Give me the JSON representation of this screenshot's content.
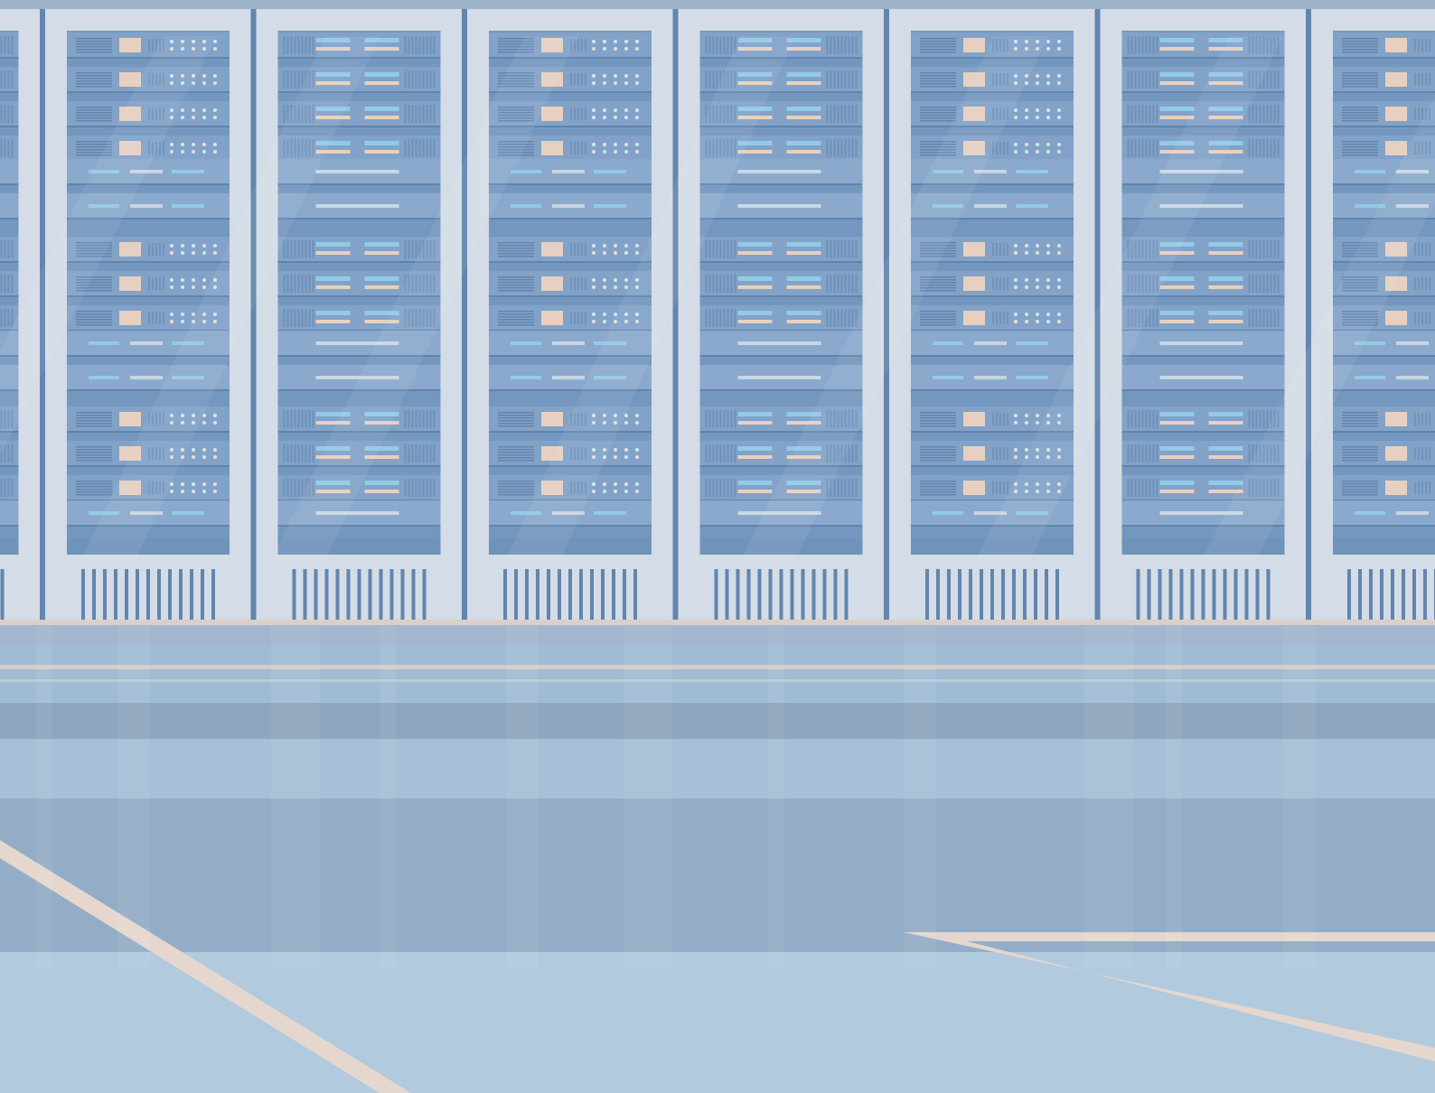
{
  "scene": {
    "kind": "illustration",
    "subject": "server-room",
    "rack_count": 7,
    "partial_racks": 2,
    "units_per_rack": 15,
    "colors": {
      "wall": "#8fa7c1",
      "rack_frame": "#d2dbe6",
      "rack_shadow": "#5d81ab",
      "cabinet": "#6f93bd",
      "unit": "#7d9fc6",
      "unit_dark": "#5b7fab",
      "led_blue": "#8ec8e6",
      "led_beige": "#e6cfbf",
      "floor": "#9dbad4",
      "floor_light": "#aec8dd",
      "floor_line": "#e4d6cc"
    }
  }
}
